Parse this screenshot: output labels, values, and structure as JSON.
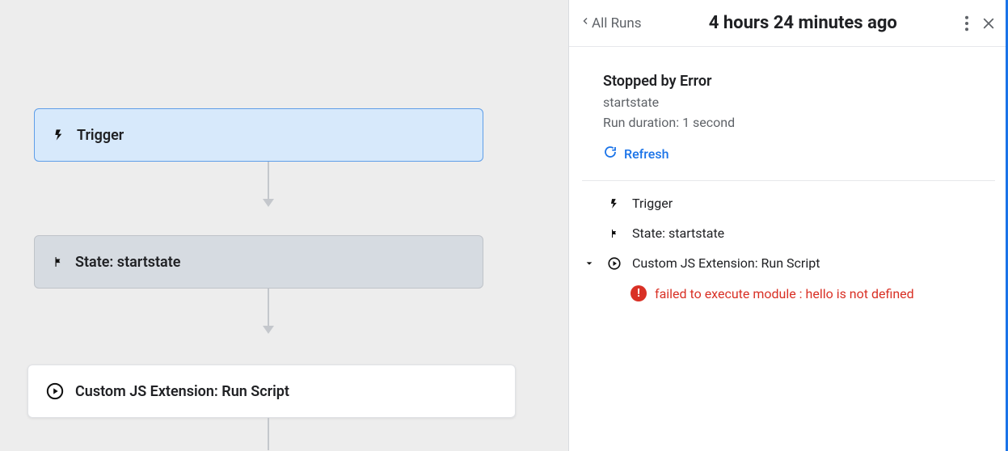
{
  "flow": {
    "trigger_label": "Trigger",
    "state_label": "State: startstate",
    "custom_label": "Custom JS Extension: Run Script"
  },
  "panel": {
    "back_label": "All Runs",
    "title": "4 hours 24 minutes ago",
    "status": {
      "title": "Stopped by Error",
      "state_name": "startstate",
      "duration": "Run duration: 1 second",
      "refresh_label": "Refresh"
    },
    "steps": {
      "trigger": "Trigger",
      "state": "State: startstate",
      "custom": "Custom JS Extension: Run Script"
    },
    "error_message": "failed to execute module : hello is not defined"
  }
}
